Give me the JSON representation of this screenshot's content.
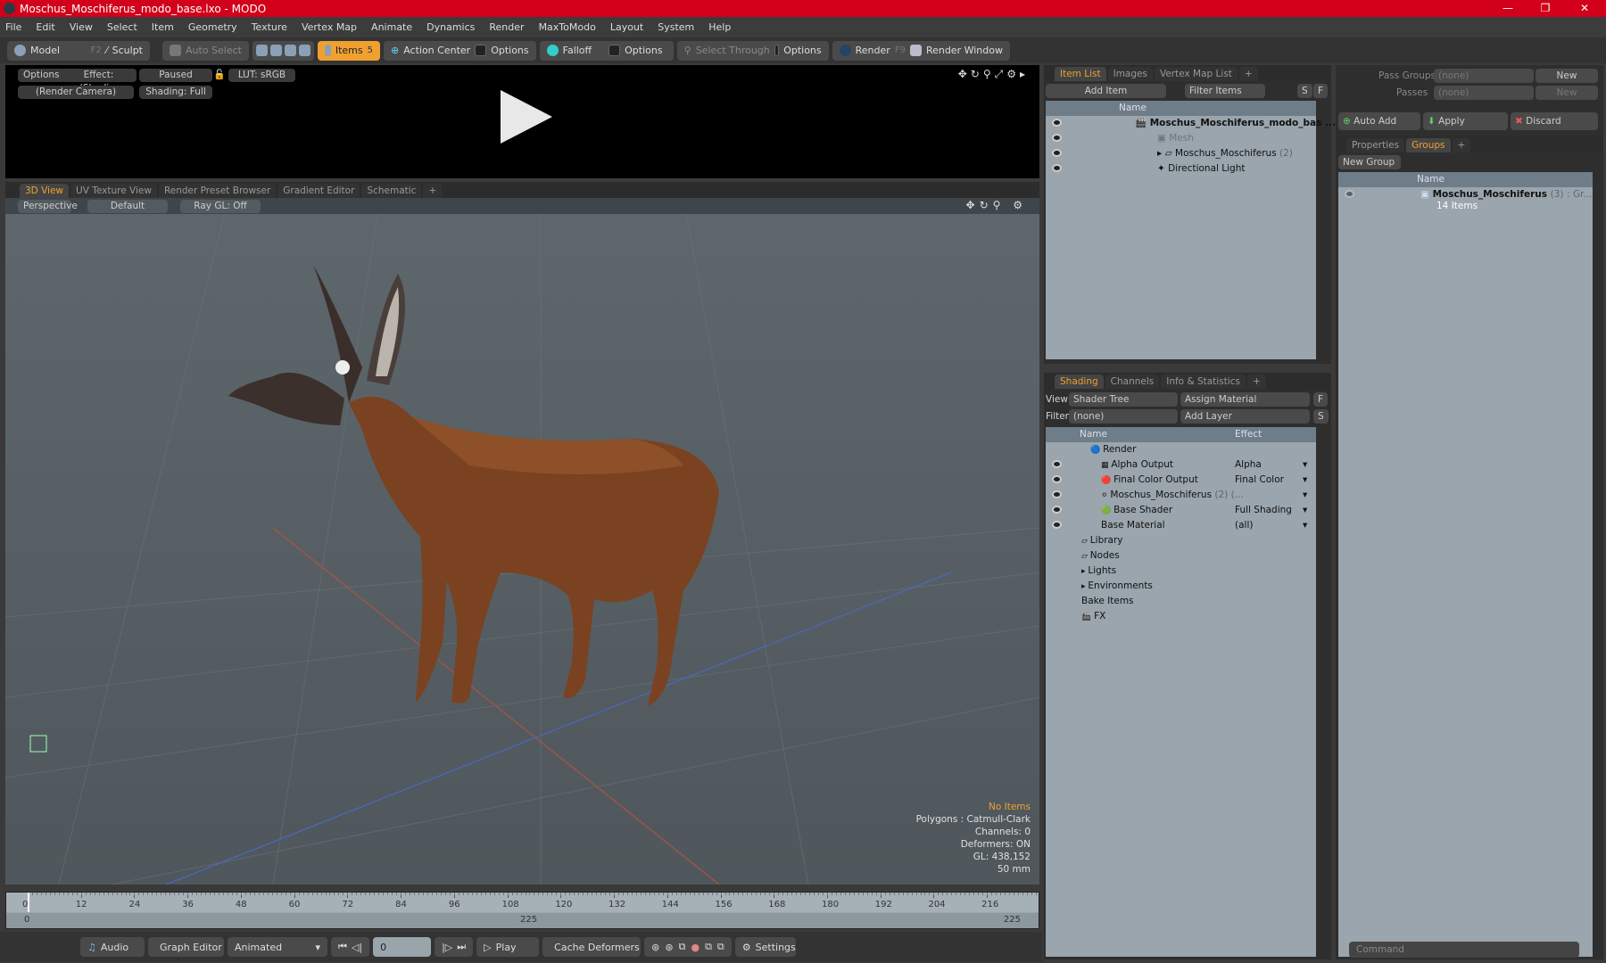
{
  "window": {
    "title": "Moschus_Moschiferus_modo_base.lxo - MODO",
    "controls": [
      "—",
      "❐",
      "✕"
    ]
  },
  "menu": [
    "File",
    "Edit",
    "View",
    "Select",
    "Item",
    "Geometry",
    "Texture",
    "Vertex Map",
    "Animate",
    "Dynamics",
    "Render",
    "MaxToModo",
    "Layout",
    "System",
    "Help"
  ],
  "toolbar": {
    "model": "Model",
    "model_key": "F2",
    "sculpt": "Sculpt",
    "auto_select": "Auto Select",
    "items": "Items",
    "items_key": "5",
    "action_center": "Action Center",
    "options1": "Options",
    "falloff": "Falloff",
    "options2": "Options",
    "select_through": "Select Through",
    "options3": "Options",
    "render": "Render",
    "render_key": "F9",
    "render_window": "Render Window"
  },
  "preview": {
    "options": "Options",
    "effect": "Effect: (Shadi...",
    "paused": "Paused",
    "lut": "LUT: sRGB",
    "camera": "(Render Camera)",
    "shading": "Shading: Full"
  },
  "viewport_tabs": [
    "3D View",
    "UV Texture View",
    "Render Preset Browser",
    "Gradient Editor",
    "Schematic",
    "+"
  ],
  "viewport": {
    "projection": "Perspective",
    "style": "Default",
    "raygl": "Ray GL: Off",
    "info": [
      "No Items",
      "Polygons : Catmull-Clark",
      "Channels: 0",
      "Deformers: ON",
      "GL: 438,152",
      "50 mm"
    ],
    "accent": "#f0a030"
  },
  "timeline": {
    "ticks": [
      0,
      12,
      24,
      36,
      48,
      60,
      72,
      84,
      96,
      108,
      120,
      132,
      144,
      156,
      168,
      180,
      192,
      204,
      216
    ],
    "range_start": "0",
    "range_mid": "225",
    "range_end": "225",
    "current": 0
  },
  "bottombar": {
    "audio": "Audio",
    "graph_editor": "Graph Editor",
    "animated": "Animated",
    "frame": "0",
    "play": "Play",
    "cache": "Cache Deformers",
    "settings": "Settings"
  },
  "itemlist": {
    "tabs": [
      "Item List",
      "Images",
      "Vertex Map List",
      "+"
    ],
    "add_item": "Add Item",
    "filter": "Filter Items",
    "s": "S",
    "f": "F",
    "col_name": "Name",
    "rows": [
      {
        "name": "Moschus_Moschiferus_modo_bas ...",
        "bold": true
      },
      {
        "name": "Mesh",
        "dim": true
      },
      {
        "name": "Moschus_Moschiferus",
        "count": "(2)"
      },
      {
        "name": "Directional Light"
      }
    ]
  },
  "shading": {
    "tabs": [
      "Shading",
      "Channels",
      "Info & Statistics",
      "+"
    ],
    "view_label": "View",
    "view": "Shader Tree",
    "assign": "Assign Material",
    "f": "F",
    "filter_label": "Filter",
    "filter": "(none)",
    "add_layer": "Add Layer",
    "s": "S",
    "col_name": "Name",
    "col_effect": "Effect",
    "rows": [
      {
        "name": "Render",
        "effect": ""
      },
      {
        "name": "Alpha Output",
        "effect": "Alpha"
      },
      {
        "name": "Final Color Output",
        "effect": "Final Color"
      },
      {
        "name": "Moschus_Moschiferus",
        "count": "(2) (...",
        "effect": ""
      },
      {
        "name": "Base Shader",
        "effect": "Full Shading"
      },
      {
        "name": "Base Material",
        "effect": "(all)"
      },
      {
        "name": "Library"
      },
      {
        "name": "Nodes"
      },
      {
        "name": "Lights"
      },
      {
        "name": "Environments"
      },
      {
        "name": "Bake Items"
      },
      {
        "name": "FX"
      }
    ]
  },
  "passes": {
    "pass_groups_label": "Pass Groups",
    "pass_groups": "(none)",
    "new1": "New",
    "passes_label": "Passes",
    "passes": "(none)",
    "new2": "New",
    "auto_add": "Auto Add",
    "apply": "Apply",
    "discard": "Discard"
  },
  "groups": {
    "tabs": [
      "Properties",
      "Groups",
      "+"
    ],
    "new_group": "New Group",
    "col_name": "Name",
    "group_name": "Moschus_Moschiferus",
    "group_count": "(3)",
    "group_suffix": ": Gr...",
    "group_items": "14 Items"
  },
  "command": {
    "placeholder": "Command"
  }
}
